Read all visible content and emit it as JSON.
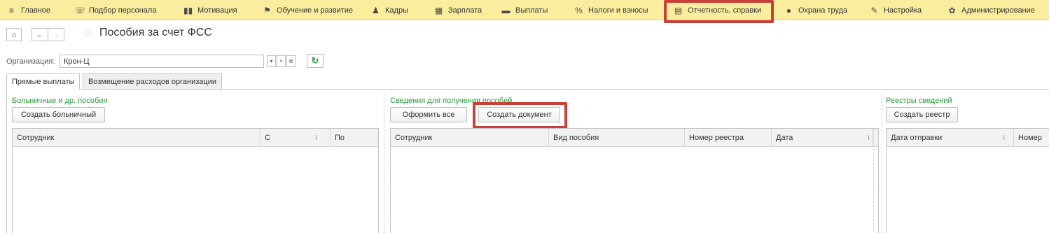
{
  "menu": {
    "items": [
      {
        "label": "Главное",
        "icon": "≡"
      },
      {
        "label": "Подбор персонала",
        "icon": "☏"
      },
      {
        "label": "Мотивация",
        "icon": "▮▮"
      },
      {
        "label": "Обучение и развитие",
        "icon": "⚑"
      },
      {
        "label": "Кадры",
        "icon": "♟"
      },
      {
        "label": "Зарплата",
        "icon": "▦"
      },
      {
        "label": "Выплаты",
        "icon": "▬"
      },
      {
        "label": "Налоги и взносы",
        "icon": "%"
      },
      {
        "label": "Отчетность, справки",
        "icon": "▤"
      },
      {
        "label": "Охрана труда",
        "icon": "●"
      },
      {
        "label": "Настройка",
        "icon": "✎"
      },
      {
        "label": "Администрирование",
        "icon": "✿"
      }
    ]
  },
  "title_bar": {
    "home_icon": "⌂",
    "back_icon": "←",
    "forward_icon": "→",
    "star_icon": "☆",
    "title": "Пособия за счет ФСС"
  },
  "organization": {
    "label": "Организация:",
    "value": "Крон-Ц",
    "dropdown_icon": "▾",
    "clear_icon": "×",
    "open_icon": "⧉",
    "refresh_icon": "↻"
  },
  "tabs": [
    {
      "label": "Прямые выплаты",
      "active": true
    },
    {
      "label": "Возмещение расходов организации",
      "active": false
    }
  ],
  "sections": {
    "sick": {
      "title": "Больничные и др. пособия",
      "buttons": [
        "Создать больничный"
      ],
      "columns": [
        "Сотрудник",
        "С",
        "По"
      ],
      "sort_icon": "↓"
    },
    "benefits": {
      "title": "Сведения для получения пособий",
      "buttons": [
        "Оформить все",
        "Создать документ"
      ],
      "columns": [
        "Сотрудник",
        "Вид пособия",
        "Номер реестра",
        "Дата"
      ],
      "sort_icon": "↓"
    },
    "registries": {
      "title": "Реестры сведений",
      "buttons": [
        "Создать реестр"
      ],
      "columns": [
        "Дата отправки",
        "Номер"
      ],
      "sort_icon": "↓"
    }
  },
  "colors": {
    "menu_bg": "#fbed9e",
    "highlight": "#c9403a",
    "group_title": "#2c9a3c"
  }
}
